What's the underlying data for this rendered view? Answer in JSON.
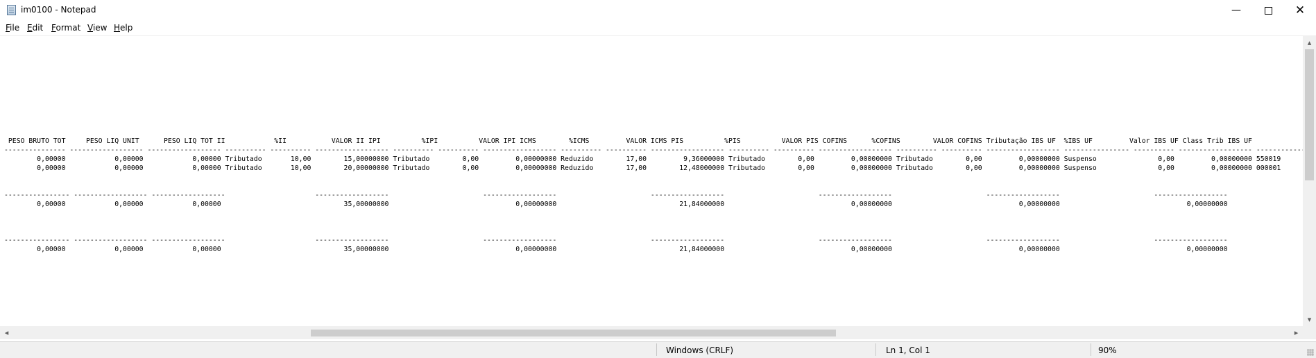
{
  "window": {
    "title": "im0100 - Notepad",
    "minimize_icon": "minimize-icon",
    "maximize_icon": "maximize-icon",
    "close_icon": "close-icon"
  },
  "menu": [
    "File",
    "Edit",
    "Format",
    "View",
    "Help"
  ],
  "editor": {
    "content": "\n\n\n\n\n\n\n\n\n\n PESO BRUTO TOT     PESO LIQ UNIT      PESO LIQ TOT II            %II           VALOR II IPI          %IPI          VALOR IPI ICMS        %ICMS         VALOR ICMS PIS          %PIS          VALOR PIS COFINS      %COFINS        VALOR COFINS Tributação IBS UF  %IBS UF         Valor IBS UF Class Trib IBS UF\n--------------- ------------------ ------------------ ---------- ---------- ------------------ ---------- ---------- ------------------ ---------- ---------- ------------------ ---------- ---------- ------------------ ---------- ---------- ------------------ ---------------- ---------- ------------------ ------------------\n        0,00000            0,00000            0,00000 Tributado       10,00        15,00000000 Tributado        0,00         0,00000000 Reduzido        17,00         9,36000000 Tributado        0,00         0,00000000 Tributado        0,00         0,00000000 Suspenso               0,00         0,00000000 550019\n        0,00000            0,00000            0,00000 Tributado       10,00        20,00000000 Tributado        0,00         0,00000000 Reduzido        17,00        12,48000000 Tributado        0,00         0,00000000 Tributado        0,00         0,00000000 Suspenso               0,00         0,00000000 000001\n\n\n---------------- ------------------ ------------------                      ------------------                       ------------------                       ------------------                       ------------------                       ------------------                       ------------------\n        0,00000            0,00000            0,00000                              35,00000000                               0,00000000                              21,84000000                               0,00000000                               0,00000000                               0,00000000\n\n\n\n---------------- ------------------ ------------------                      ------------------                       ------------------                       ------------------                       ------------------                       ------------------                       ------------------\n        0,00000            0,00000            0,00000                              35,00000000                               0,00000000                              21,84000000                               0,00000000                               0,00000000                               0,00000000"
  },
  "statusbar": {
    "line_ending": "Windows (CRLF)",
    "position": "Ln 1, Col 1",
    "zoom": "90%"
  }
}
